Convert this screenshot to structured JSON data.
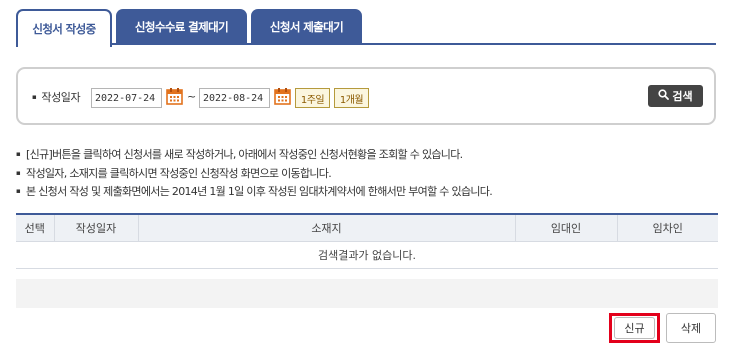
{
  "tabs": [
    {
      "label": "신청서 작성중",
      "active": true
    },
    {
      "label": "신청수수료 결제대기",
      "active": false
    },
    {
      "label": "신청서 제출대기",
      "active": false
    }
  ],
  "search": {
    "date_label": "작성일자",
    "start_date": "2022-07-24",
    "separator": "~",
    "end_date": "2022-08-24",
    "period_week": "1주일",
    "period_month": "1개월",
    "search_button": "검색"
  },
  "notes": [
    "[신규]버튼을 클릭하여 신청서를 새로 작성하거나, 아래에서 작성중인 신청서현황을 조회할 수 있습니다.",
    "작성일자, 소재지를 클릭하시면 작성중인 신청작성 화면으로 이동합니다.",
    "본 신청서 작성 및 제출화면에서는 2014년 1월 1일 이후 작성된 임대차계약서에 한해서만 부여할 수 있습니다."
  ],
  "table": {
    "columns": [
      "선택",
      "작성일자",
      "소재지",
      "임대인",
      "임차인"
    ],
    "empty_message": "검색결과가 없습니다."
  },
  "actions": {
    "new_label": "신규",
    "delete_label": "삭제"
  },
  "colors": {
    "tab_blue": "#3e5a98",
    "highlight_red": "#e3001b",
    "calendar_orange": "#e2731e"
  },
  "icons": {
    "calendar": "calendar-icon",
    "search": "magnifier-icon"
  }
}
